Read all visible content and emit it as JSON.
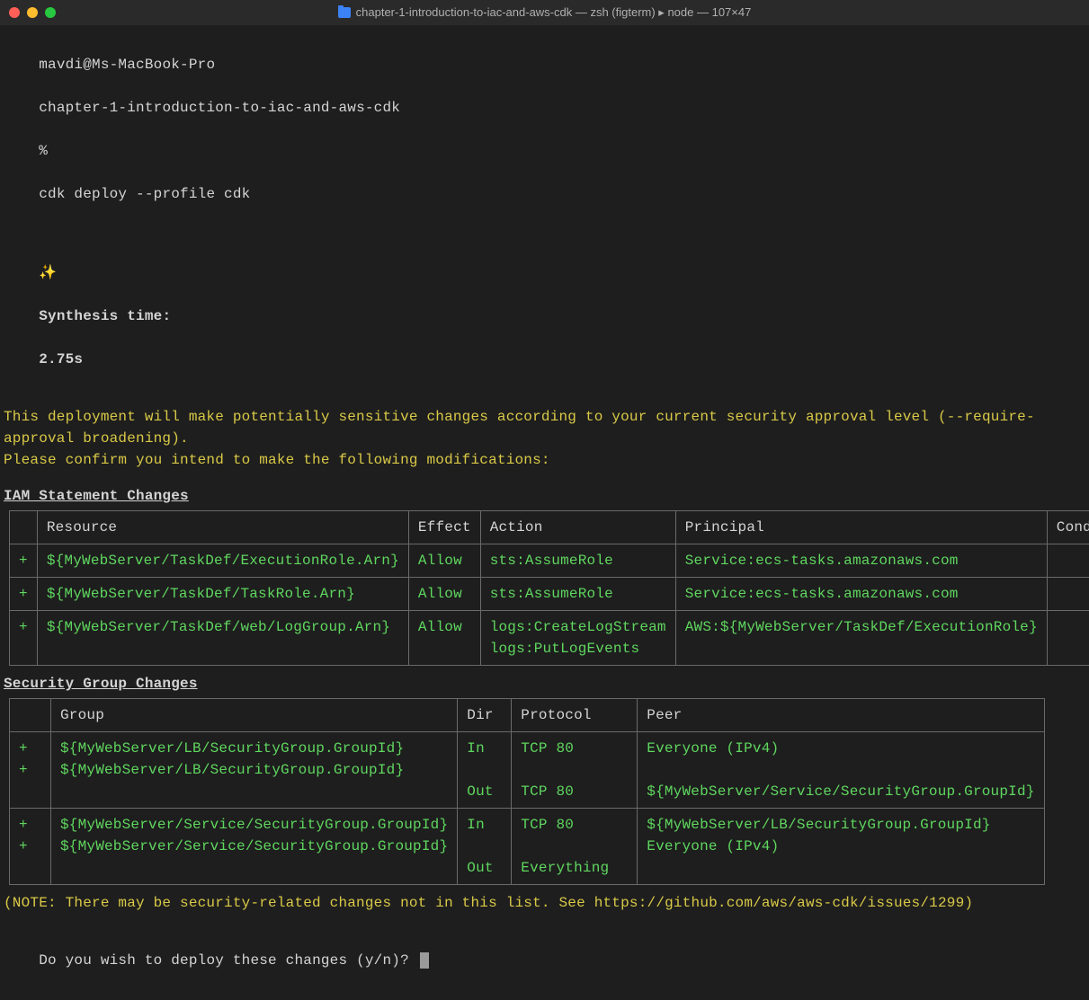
{
  "window": {
    "title": "chapter-1-introduction-to-iac-and-aws-cdk — zsh (figterm) ▸ node — 107×47"
  },
  "prompt": {
    "userhost": "mavdi@Ms-MacBook-Pro",
    "cwd": "chapter-1-introduction-to-iac-and-aws-cdk",
    "symbol": "%",
    "command": "cdk deploy --profile cdk"
  },
  "synthesis": {
    "sparkle": "✨",
    "label": "Synthesis time:",
    "value": "2.75s"
  },
  "warning": {
    "line1": "This deployment will make potentially sensitive changes according to your current security approval level (--require-approval broadening).",
    "line2": "Please confirm you intend to make the following modifications:"
  },
  "iam": {
    "heading": "IAM Statement Changes",
    "headers": [
      "",
      "Resource",
      "Effect",
      "Action",
      "Principal",
      "Condition"
    ],
    "rows": [
      {
        "mark": "+",
        "resource": "${MyWebServer/TaskDef/ExecutionRole.Arn}",
        "effect": "Allow",
        "action": "sts:AssumeRole",
        "principal": "Service:ecs-tasks.amazonaws.com",
        "condition": ""
      },
      {
        "mark": "+",
        "resource": "${MyWebServer/TaskDef/TaskRole.Arn}",
        "effect": "Allow",
        "action": "sts:AssumeRole",
        "principal": "Service:ecs-tasks.amazonaws.com",
        "condition": ""
      },
      {
        "mark": "+",
        "resource": "${MyWebServer/TaskDef/web/LogGroup.Arn}",
        "effect": "Allow",
        "action": "logs:CreateLogStream\nlogs:PutLogEvents",
        "principal": "AWS:${MyWebServer/TaskDef/ExecutionRole}",
        "condition": ""
      }
    ]
  },
  "sg": {
    "heading": "Security Group Changes",
    "headers": [
      "",
      "Group",
      "Dir",
      "Protocol",
      "Peer"
    ],
    "rows": [
      {
        "mark": "+\n+",
        "group": "${MyWebServer/LB/SecurityGroup.GroupId}\n${MyWebServer/LB/SecurityGroup.GroupId}",
        "dir": "In\n\nOut",
        "protocol": "TCP 80\n\nTCP 80",
        "peer": "Everyone (IPv4)\n\n${MyWebServer/Service/SecurityGroup.GroupId}"
      },
      {
        "mark": "+\n+",
        "group": "${MyWebServer/Service/SecurityGroup.GroupId}\n${MyWebServer/Service/SecurityGroup.GroupId}",
        "dir": "In\n\nOut",
        "protocol": "TCP 80\n\nEverything",
        "peer": "${MyWebServer/LB/SecurityGroup.GroupId}\nEveryone (IPv4)"
      }
    ]
  },
  "note": "(NOTE: There may be security-related changes not in this list. See https://github.com/aws/aws-cdk/issues/1299)",
  "confirm": "Do you wish to deploy these changes (y/n)? "
}
